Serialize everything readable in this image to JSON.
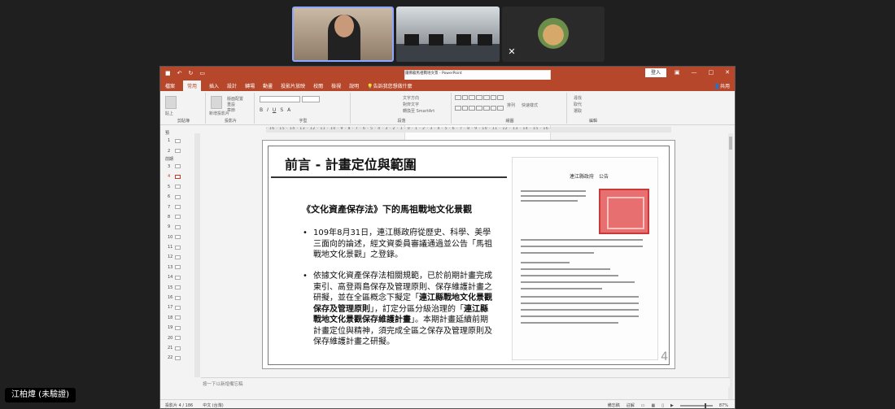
{
  "meeting": {
    "participant_name": "江柏煒 (未驗證)"
  },
  "ppt": {
    "doc_title": "鐵佛龍馬祖戰地文景 - PowerPoint",
    "signin": "登入",
    "share": "共用",
    "tabs": [
      "檔案",
      "常用",
      "插入",
      "設計",
      "轉場",
      "動畫",
      "投影片放映",
      "校閱",
      "檢視",
      "說明"
    ],
    "search": "告訴我您想做什麼",
    "groups": [
      "剪貼簿",
      "投影片",
      "字型",
      "段落",
      "繪圖",
      "編輯"
    ],
    "ribbon_labels": {
      "paste": "貼上",
      "new_slide": "新增投影片",
      "layout": "版面配置",
      "reset": "重設",
      "section": "章節",
      "text_dir": "文字方向",
      "align_text": "對齊文字",
      "smartart": "轉換至 SmartArt",
      "arrange": "排列",
      "quick_styles": "快速樣式",
      "find": "尋找",
      "replace": "取代",
      "select": "選取"
    },
    "ruler_text": "· 16 · 15 · 14 · 13 · 12 · 11 · 10 · 9 · 8 · 7 · 6 · 5 · 4 · 3 · 2 · 1 · 0 · 1 · 2 · 3 · 4 · 5 · 6 · 7 · 8 · 9 · 10 · 11 · 12 · 13 · 14 · 15 · 16 ·",
    "thumb_sections": [
      "預",
      "前期"
    ],
    "thumbs": [
      "1",
      "2",
      "3",
      "4",
      "5",
      "6",
      "7",
      "8",
      "9",
      "10",
      "11",
      "12",
      "13",
      "14",
      "15",
      "16",
      "17",
      "18",
      "19",
      "20",
      "21",
      "22"
    ],
    "active_slide": "4",
    "notes_placeholder": "按一下以新增備忘稿",
    "status_left": [
      "投影片 4 / 186",
      "中文 (台灣)"
    ],
    "status_right": [
      "備忘稿",
      "註解",
      "87%"
    ]
  },
  "slide": {
    "title": "前言 - 計畫定位與範圍",
    "subtitle": "《文化資產保存法》下的馬祖戰地文化景觀",
    "bullet1": "109年8月31日，連江縣政府從歷史、科學、美學三面向的論述，經文資委員審議通過並公告「馬祖戰地文化景觀」之登錄。",
    "bullet2_a": "依據文化資產保存法相關規範，已於前期計畫完成東引、高登兩島保存及管理原則、保存維護計畫之研擬，並在全區概念下擬定「",
    "bullet2_hl1": "連江縣戰地文化景觀保存及管理原則",
    "bullet2_b": "」，訂定分區分級治理的「",
    "bullet2_hl2": "連江縣戰地文化景觀保存維護計畫",
    "bullet2_c": "」。本期計畫延續前期計畫定位與精神，須完成全區之保存及管理原則及保存維護計畫之研擬。",
    "doc_org": "連江縣政府　公告",
    "page_number": "4"
  }
}
